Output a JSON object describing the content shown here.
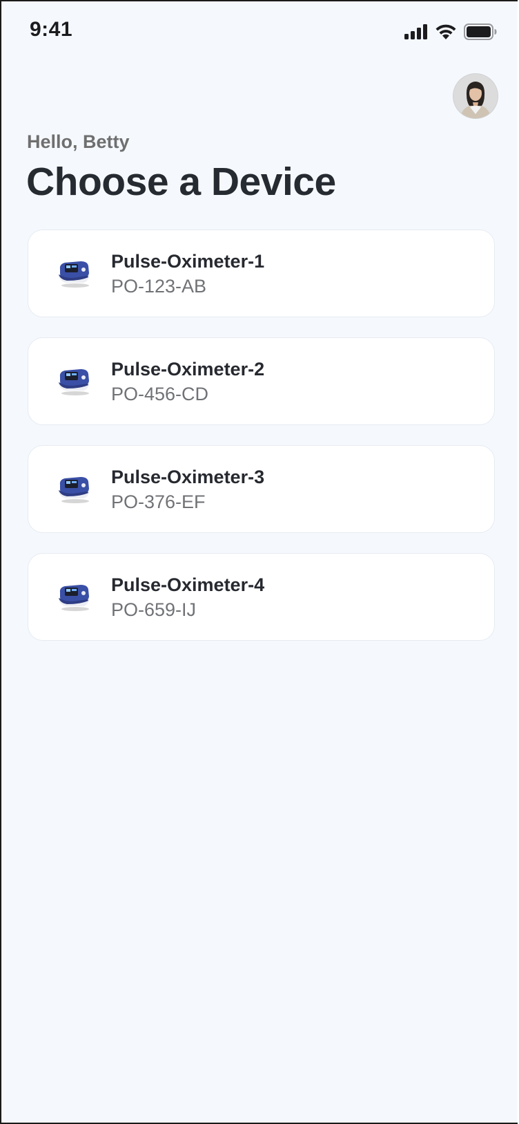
{
  "status_bar": {
    "time": "9:41",
    "icons": [
      "cellular-signal-icon",
      "wifi-icon",
      "battery-icon"
    ]
  },
  "header": {
    "greeting": "Hello, Betty",
    "title": "Choose a Device"
  },
  "devices": [
    {
      "name": "Pulse-Oximeter-1",
      "serial": "PO-123-AB",
      "icon": "pulse-oximeter-icon"
    },
    {
      "name": "Pulse-Oximeter-2",
      "serial": "PO-456-CD",
      "icon": "pulse-oximeter-icon"
    },
    {
      "name": "Pulse-Oximeter-3",
      "serial": "PO-376-EF",
      "icon": "pulse-oximeter-icon"
    },
    {
      "name": "Pulse-Oximeter-4",
      "serial": "PO-659-IJ",
      "icon": "pulse-oximeter-icon"
    }
  ],
  "colors": {
    "background": "#f5f9fe",
    "card": "#ffffff",
    "title": "#262a31",
    "secondary_text": "#707276",
    "device_accent": "#3a4fa6"
  }
}
